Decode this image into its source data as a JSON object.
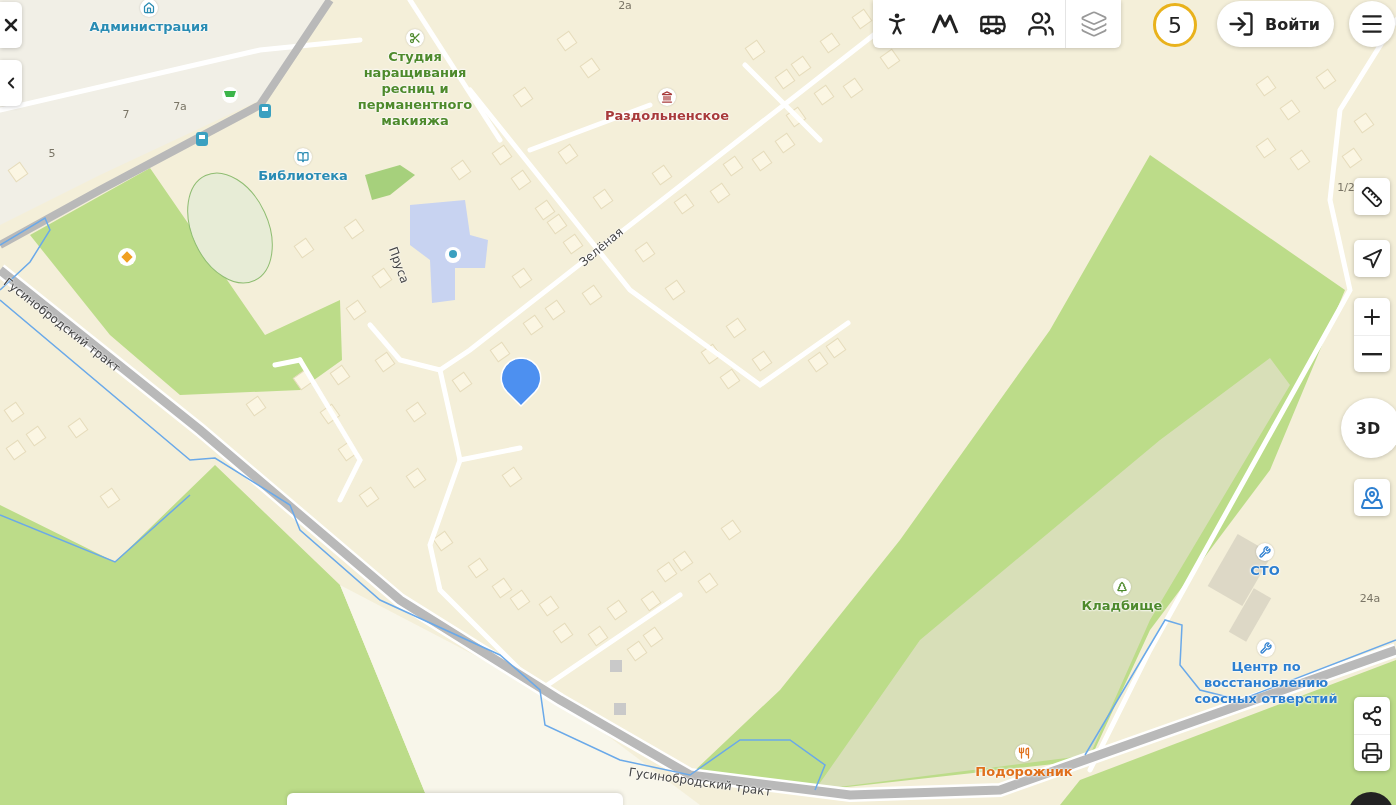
{
  "map": {
    "places": [
      {
        "name": "Администрация",
        "kind": "admin",
        "color": "#2a8cb3"
      },
      {
        "name": "Студия наращивания ресниц и перманентного макияжа",
        "kind": "beauty",
        "color": "#4e8a2c"
      },
      {
        "name": "Раздольненское",
        "kind": "landmark",
        "color": "#a83a3a"
      },
      {
        "name": "Библиотека",
        "kind": "library",
        "color": "#2a8cb3"
      },
      {
        "name": "Кладбище",
        "kind": "cemetery",
        "color": "#4e8a2c"
      },
      {
        "name": "СТО",
        "kind": "service",
        "color": "#2d7fd0"
      },
      {
        "name": "Центр по восстановлению соосных отверстий",
        "kind": "service",
        "color": "#2d7fd0"
      },
      {
        "name": "Подорожник",
        "kind": "food",
        "color": "#e0701c"
      }
    ],
    "streets": [
      "Зелёная",
      "Пруса",
      "Гусинобродский тракт",
      "Гусинобродский тракт"
    ],
    "house_numbers": [
      "2а",
      "7",
      "7а",
      "5",
      "1/2",
      "24а"
    ]
  },
  "counter": "5",
  "login_button": "Войти",
  "view_button": "3D"
}
